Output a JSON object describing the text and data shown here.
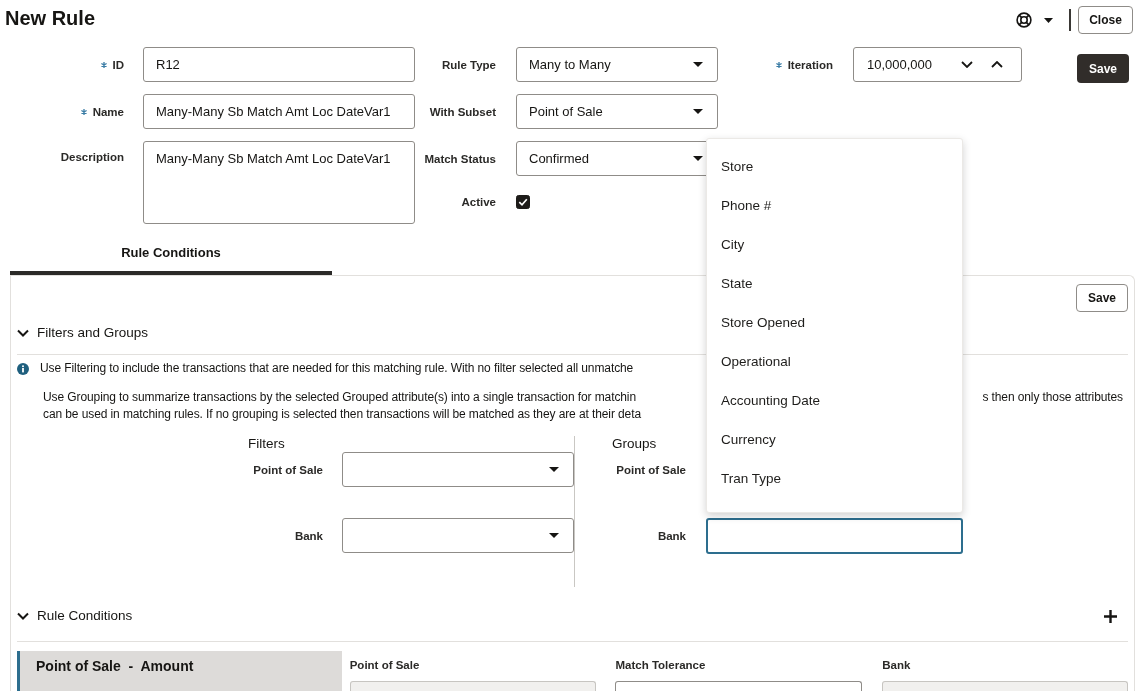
{
  "page": {
    "title": "New Rule",
    "close_button": "Close"
  },
  "rule_form": {
    "left_fields": [
      {
        "kind": "text",
        "label": "ID",
        "required": true,
        "value": "R12"
      },
      {
        "kind": "text",
        "label": "Name",
        "required": true,
        "value": "Many-Many Sb Match Amt Loc DateVar1"
      },
      {
        "kind": "textarea",
        "label": "Description",
        "required": false,
        "value": "Many-Many Sb Match Amt Loc DateVar1"
      }
    ],
    "middle_fields": [
      {
        "kind": "select",
        "label": "Rule Type",
        "value": "Many to Many"
      },
      {
        "kind": "select",
        "label": "With Subset",
        "value": "Point of Sale"
      },
      {
        "kind": "select",
        "label": "Match Status",
        "value": "Confirmed"
      },
      {
        "kind": "checkbox",
        "label": "Active",
        "checked": true
      }
    ],
    "iteration": {
      "label": "Iteration",
      "required": true,
      "value": "10,000,000"
    },
    "save_button": "Save"
  },
  "tabs": [
    {
      "label": "Rule Conditions",
      "selected": true
    }
  ],
  "rule_conditions_panel": {
    "save_button": "Save",
    "filters_and_groups": {
      "title": "Filters and Groups",
      "expanded": true,
      "notes": [
        {
          "kind": "info",
          "text": "Use Filtering to include the transactions that are needed for this matching rule. With no filter selected all unmatche"
        },
        {
          "kind": "plain",
          "text": "Use Grouping to summarize transactions by the selected Grouped attribute(s) into a single transaction for matchin",
          "tail": "s then only those attributes"
        },
        {
          "kind": "plain",
          "text": "can be used in matching rules. If no grouping is selected then transactions will be matched as they are at their deta"
        }
      ],
      "filters": {
        "title": "Filters",
        "rows": [
          {
            "label": "Point of Sale",
            "kind": "select"
          },
          {
            "label": "Bank",
            "kind": "select"
          }
        ]
      },
      "groups": {
        "title": "Groups",
        "rows": [
          {
            "label": "Point of Sale",
            "kind": "covered"
          },
          {
            "label": "Bank",
            "kind": "input",
            "focused": true,
            "options": [
              "Store",
              "Phone #",
              "City",
              "State",
              "Store Opened",
              "Operational",
              "Accounting Date",
              "Currency",
              "Tran Type"
            ]
          }
        ]
      }
    },
    "rule_conditions": {
      "title": "Rule Conditions",
      "expanded": true,
      "conditions": [
        {
          "title": "Point of Sale  -  Amount",
          "selected": true,
          "columns": [
            {
              "label": "Point of Sale",
              "kind": "readonly"
            },
            {
              "label": "Match Tolerance",
              "kind": "input"
            },
            {
              "label": "Bank",
              "kind": "readonly"
            }
          ]
        }
      ]
    }
  }
}
